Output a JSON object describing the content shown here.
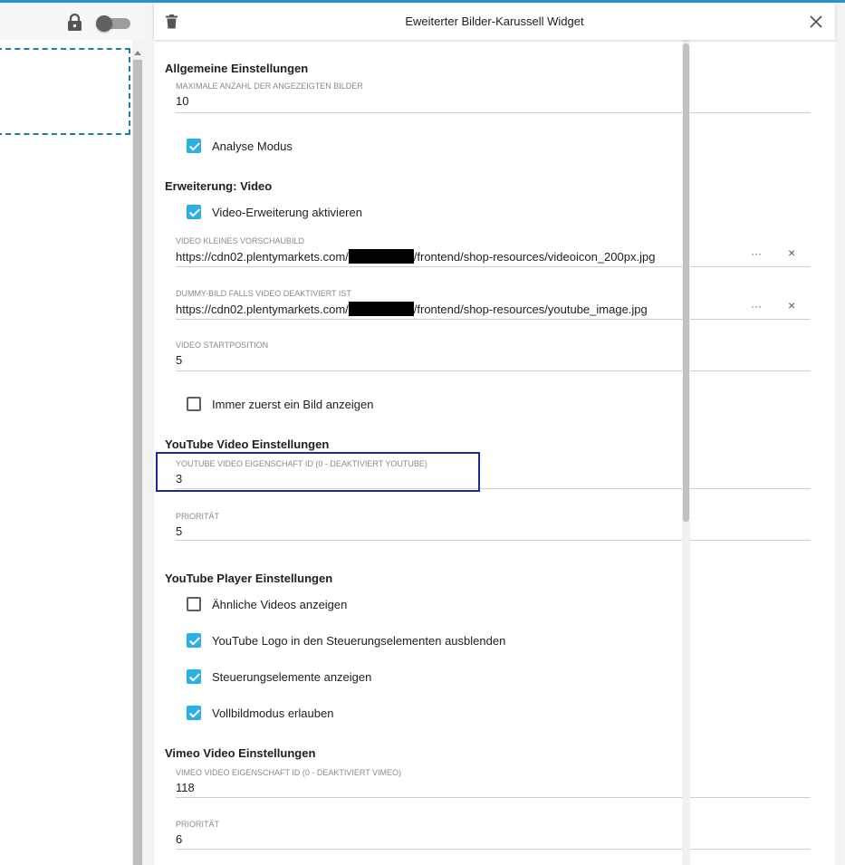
{
  "left": {
    "lock_icon": "lock-icon",
    "toggle_state": "off"
  },
  "panel": {
    "title": "Eweiterter Bilder-Karussell Widget",
    "delete_icon": "trash-icon",
    "close_icon": "close-icon"
  },
  "sections": {
    "general": "Allgemeine Einstellungen",
    "video": "Erweiterung: Video",
    "youtube_video": "YouTube Video Einstellungen",
    "youtube_player": "YouTube Player Einstellungen",
    "vimeo": "Vimeo Video Einstellungen"
  },
  "fields": {
    "max_images": {
      "label": "MAXIMALE ANZAHL DER ANGEZEIGTEN BILDER",
      "value": "10"
    },
    "video_thumb": {
      "label": "VIDEO KLEINES VORSCHAUBILD",
      "prefix": "https://cdn02.plentymarkets.com/",
      "suffix": "/frontend/shop-resources/videoicon_200px.jpg"
    },
    "dummy_image": {
      "label": "DUMMY-BILD FALLS VIDEO DEAKTIVIERT IST",
      "prefix": "https://cdn02.plentymarkets.com/",
      "suffix": "/frontend/shop-resources/youtube_image.jpg"
    },
    "video_start": {
      "label": "VIDEO STARTPOSITION",
      "value": "5"
    },
    "youtube_prop": {
      "label": "YOUTUBE VIDEO EIGENSCHAFT ID (0 - DEAKTIVIERT YOUTUBE)",
      "value": "3"
    },
    "youtube_prio": {
      "label": "PRIORITÄT",
      "value": "5"
    },
    "vimeo_prop": {
      "label": "VIMEO VIDEO EIGENSCHAFT ID (0 - DEAKTIVIERT VIMEO)",
      "value": "118"
    },
    "vimeo_prio": {
      "label": "PRIORITÄT",
      "value": "6"
    },
    "more_label": "···",
    "clear_label": "×"
  },
  "checks": {
    "analyse": {
      "label": "Analyse Modus",
      "checked": true
    },
    "video_ext": {
      "label": "Video-Erweiterung aktivieren",
      "checked": true
    },
    "image_first": {
      "label": "Immer zuerst ein Bild anzeigen",
      "checked": false
    },
    "similar": {
      "label": "Ähnliche Videos anzeigen",
      "checked": false
    },
    "hide_logo": {
      "label": "YouTube Logo in den Steuerungselementen ausblenden",
      "checked": true
    },
    "controls": {
      "label": "Steuerungselemente anzeigen",
      "checked": true
    },
    "fullscreen": {
      "label": "Vollbildmodus erlauben",
      "checked": true
    }
  },
  "colors": {
    "accent": "#2bb0e6",
    "highlight": "#1a2aa0",
    "dashed": "#1f7fa0",
    "topline": "#2b8fd6"
  }
}
